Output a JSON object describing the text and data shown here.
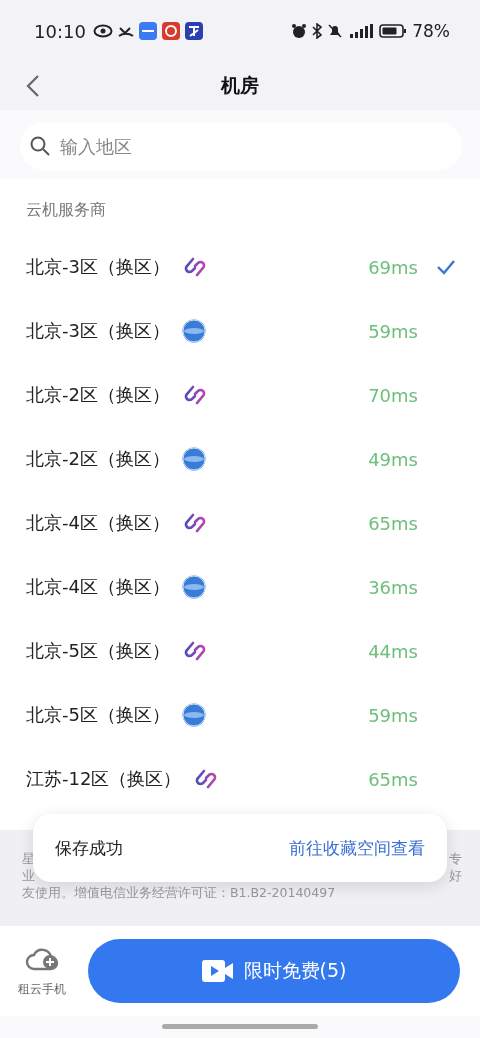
{
  "status_bar": {
    "time": "10:10",
    "battery": "78%"
  },
  "nav": {
    "title": "机房"
  },
  "search": {
    "placeholder": "输入地区"
  },
  "section": {
    "title": "云机服务商"
  },
  "rooms": [
    {
      "name": "北京-3区（换区）",
      "kind": "link",
      "latency": "69ms",
      "selected": true
    },
    {
      "name": "北京-3区（换区）",
      "kind": "globe",
      "latency": "59ms",
      "selected": false
    },
    {
      "name": "北京-2区（换区）",
      "kind": "link",
      "latency": "70ms",
      "selected": false
    },
    {
      "name": "北京-2区（换区）",
      "kind": "globe",
      "latency": "49ms",
      "selected": false
    },
    {
      "name": "北京-4区（换区）",
      "kind": "link",
      "latency": "65ms",
      "selected": false
    },
    {
      "name": "北京-4区（换区）",
      "kind": "globe",
      "latency": "36ms",
      "selected": false
    },
    {
      "name": "北京-5区（换区）",
      "kind": "link",
      "latency": "44ms",
      "selected": false
    },
    {
      "name": "北京-5区（换区）",
      "kind": "globe",
      "latency": "59ms",
      "selected": false
    },
    {
      "name": "江苏-12区（换区）",
      "kind": "link",
      "latency": "65ms",
      "selected": false
    }
  ],
  "notice": {
    "line1_start": "星",
    "line1_end": "专",
    "line2_start": "业",
    "line2_end": "好",
    "line3": "友使用。增值电信业务经营许可证：B1.B2-20140497"
  },
  "toast": {
    "message": "保存成功",
    "link": "前往收藏空间查看"
  },
  "bottom": {
    "rent_label": "租云手机",
    "cta": "限时免费(5)"
  }
}
